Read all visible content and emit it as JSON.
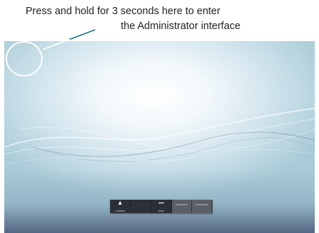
{
  "callout": {
    "line1": "Press and hold for 3 seconds here to enter",
    "line2": "the Administrator interface"
  },
  "toolbar": {
    "buttons": [
      {
        "icon": "contacts-icon",
        "label": "Contacts"
      },
      {
        "icon": "call-icon",
        "label": ""
      },
      {
        "icon": "more-icon",
        "label": "More"
      },
      {
        "icon": "",
        "label": ""
      },
      {
        "icon": "",
        "label": ""
      }
    ],
    "more_glyph": "•••",
    "contacts_glyph": "♟"
  },
  "colors": {
    "callout_pointer": "#1f6f8b",
    "hotspot_ring": "#ffffff",
    "toolbar_bg": "#2b2f36"
  }
}
